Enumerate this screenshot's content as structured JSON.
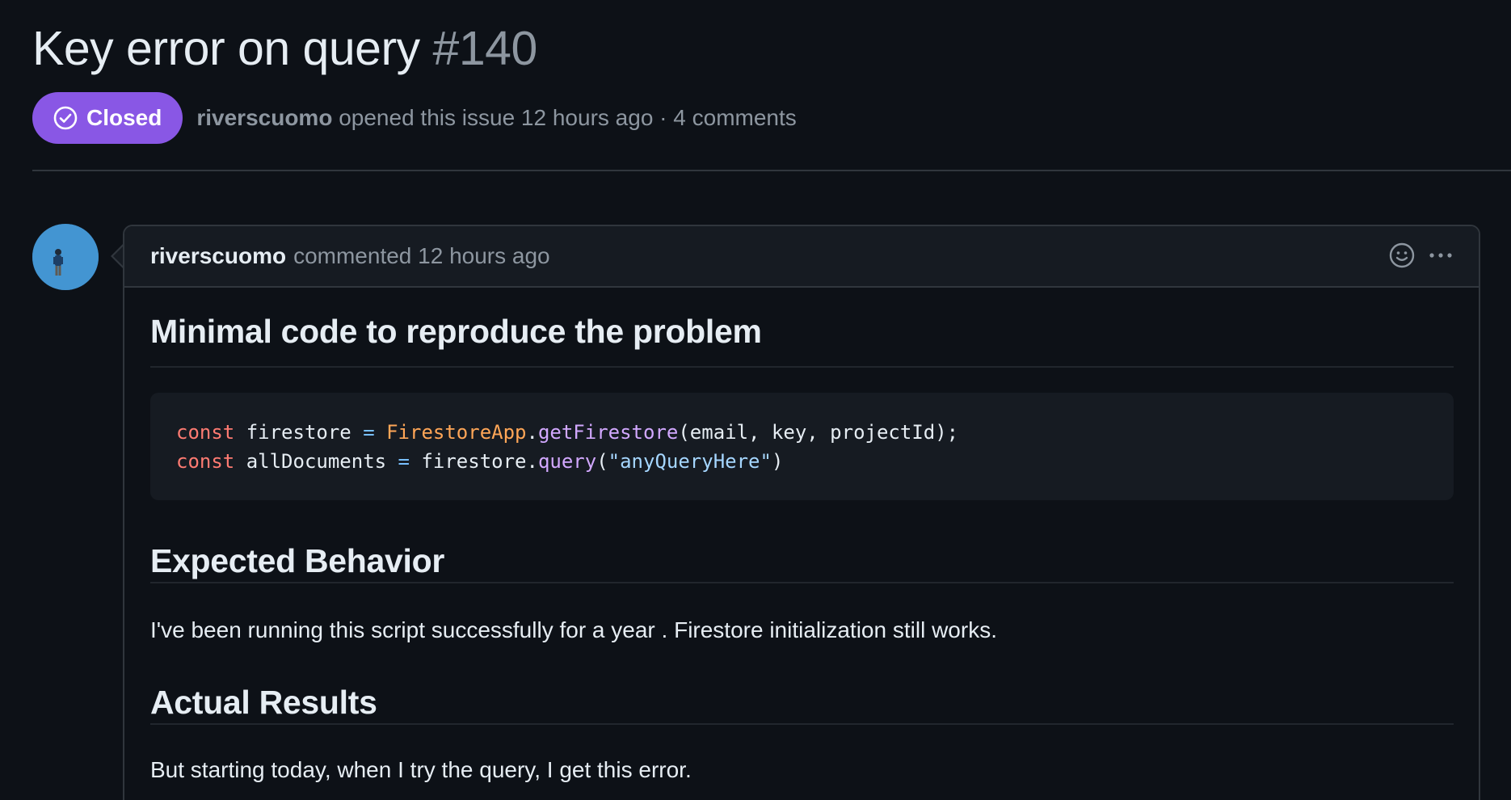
{
  "issue": {
    "title": "Key error on query",
    "number": "#140",
    "state_label": "Closed",
    "state_icon": "check-circle-icon",
    "author": "riverscuomo",
    "opened_text": "opened this issue 12 hours ago · 4 comments"
  },
  "comment": {
    "author": "riverscuomo",
    "action_text": "commented 12 hours ago",
    "actions": [
      "smiley-icon",
      "kebab-horizontal-icon"
    ],
    "heading_code": "Minimal code to reproduce the problem",
    "code_lines": [
      {
        "kw": "const",
        "var": "firestore",
        "op": "=",
        "cls": "FirestoreApp",
        "dot": ".",
        "fn": "getFirestore",
        "args": "(email, key, projectId);"
      },
      {
        "kw": "const",
        "var": "allDocuments",
        "op": "=",
        "obj": "firestore.",
        "fn": "query",
        "open": "(",
        "str": "\"anyQueryHere\"",
        "close": ")"
      }
    ],
    "heading_expected": "Expected Behavior",
    "expected_text": "I've been running this script successfully for a year . Firestore initialization still works.",
    "heading_actual": "Actual Results",
    "actual_text": "But starting today, when I try the query, I get this error."
  },
  "colors": {
    "background": "#0d1117",
    "closed_badge": "#8957e5",
    "border": "#30363d",
    "muted_text": "#8d96a0"
  }
}
